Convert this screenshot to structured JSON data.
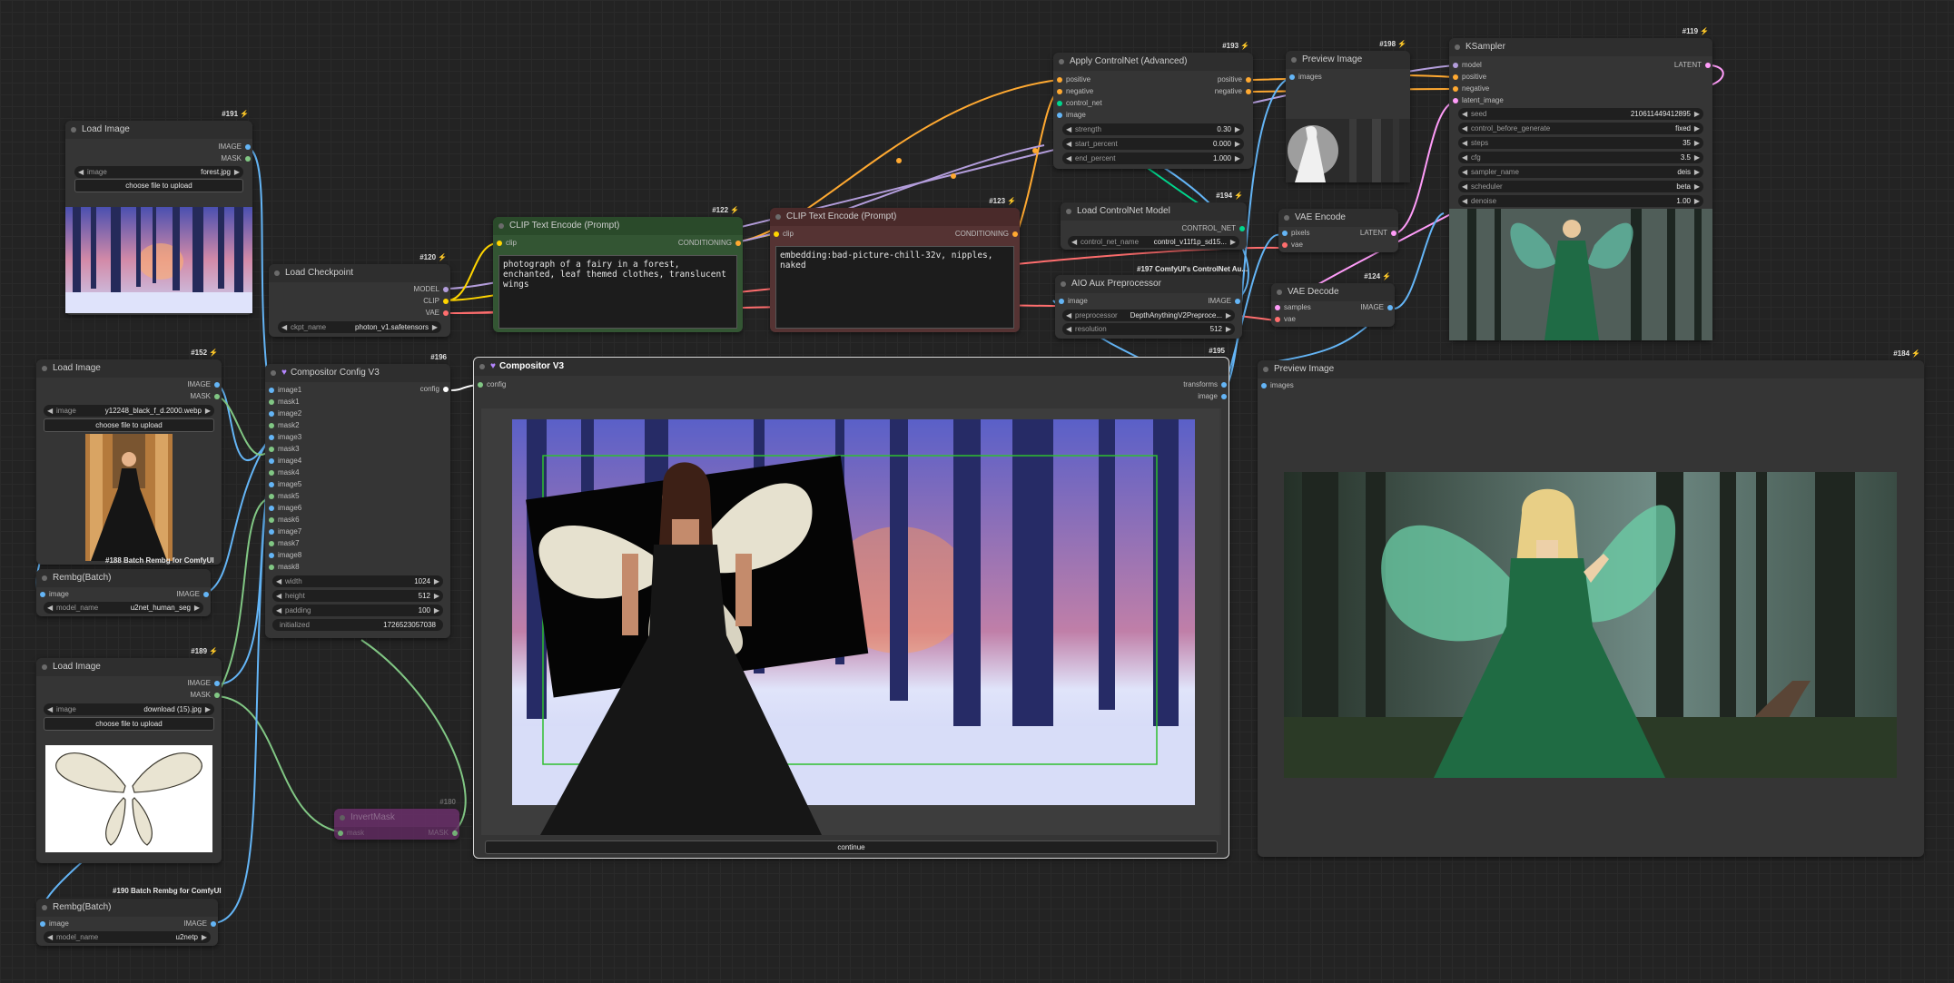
{
  "colors": {
    "image": "#64b5f6",
    "mask": "#81c784",
    "model": "#b39ddb",
    "clip": "#ffd500",
    "vae": "#ff6e6e",
    "conditioning": "#ffa931",
    "control_net": "#00d78d",
    "latent": "#ff9cf9",
    "config": "#ffffff"
  },
  "nodes": {
    "load_image_191": {
      "id": "#191",
      "title": "Load Image",
      "out_image": "IMAGE",
      "out_mask": "MASK",
      "image_label": "image",
      "image_value": "forest.jpg",
      "upload": "choose file to upload"
    },
    "load_checkpoint": {
      "id": "#120",
      "title": "Load Checkpoint",
      "out_model": "MODEL",
      "out_clip": "CLIP",
      "out_vae": "VAE",
      "ckpt_label": "ckpt_name",
      "ckpt_value": "photon_v1.safetensors"
    },
    "clip_pos": {
      "id": "#122",
      "title": "CLIP Text Encode (Prompt)",
      "in_clip": "clip",
      "out": "CONDITIONING",
      "text": "photograph of a fairy in a forest, enchanted, leaf themed clothes, translucent wings"
    },
    "clip_neg": {
      "id": "#123",
      "title": "CLIP Text Encode (Prompt)",
      "in_clip": "clip",
      "out": "CONDITIONING",
      "text": "embedding:bad-picture-chill-32v, nipples, naked"
    },
    "apply_controlnet": {
      "id": "#193",
      "title": "Apply ControlNet (Advanced)",
      "in_positive": "positive",
      "in_negative": "negative",
      "in_control_net": "control_net",
      "in_image": "image",
      "out_positive": "positive",
      "out_negative": "negative",
      "w_strength_label": "strength",
      "w_strength": "0.30",
      "w_start_label": "start_percent",
      "w_start": "0.000",
      "w_end_label": "end_percent",
      "w_end": "1.000"
    },
    "load_controlnet": {
      "id": "#194",
      "title": "Load ControlNet Model",
      "out": "CONTROL_NET",
      "name_label": "control_net_name",
      "name_value": "control_v11f1p_sd15..."
    },
    "aio_aux": {
      "id": "#197 ComfyUI's ControlNet Au...",
      "title": "AIO Aux Preprocessor",
      "in_image": "image",
      "out_image": "IMAGE",
      "pre_label": "preprocessor",
      "pre_value": "DepthAnythingV2Preproce...",
      "res_label": "resolution",
      "res_value": "512"
    },
    "preview_198": {
      "id": "#198",
      "title": "Preview Image",
      "in_images": "images"
    },
    "vae_encode": {
      "title": "VAE Encode",
      "in_pixels": "pixels",
      "in_vae": "vae",
      "out": "LATENT"
    },
    "vae_decode": {
      "id": "#124",
      "title": "VAE Decode",
      "in_samples": "samples",
      "in_vae": "vae",
      "out": "IMAGE"
    },
    "ksampler": {
      "id": "#119",
      "title": "KSampler",
      "in_model": "model",
      "in_positive": "positive",
      "in_negative": "negative",
      "in_latent": "latent_image",
      "out": "LATENT",
      "widgets": [
        {
          "label": "seed",
          "value": "210611449412895"
        },
        {
          "label": "control_before_generate",
          "value": "fixed"
        },
        {
          "label": "steps",
          "value": "35"
        },
        {
          "label": "cfg",
          "value": "3.5"
        },
        {
          "label": "sampler_name",
          "value": "deis"
        },
        {
          "label": "scheduler",
          "value": "beta"
        },
        {
          "label": "denoise",
          "value": "1.00"
        }
      ]
    },
    "load_image_152": {
      "id": "#152",
      "title": "Load Image",
      "out_image": "IMAGE",
      "out_mask": "MASK",
      "image_label": "image",
      "image_value": "y12248_black_f_d.2000.webp",
      "upload": "choose file to upload",
      "overlay": "#188 Batch Rembg for ComfyUI"
    },
    "rembg_1": {
      "title": "Rembg(Batch)",
      "in_image": "image",
      "out_image": "IMAGE",
      "model_label": "model_name",
      "model_value": "u2net_human_seg"
    },
    "compositor_config": {
      "id": "#196",
      "title": "Compositor Config V3",
      "out": "config",
      "inputs": [
        "image1",
        "mask1",
        "image2",
        "mask2",
        "image3",
        "mask3",
        "image4",
        "mask4",
        "image5",
        "mask5",
        "image6",
        "mask6",
        "image7",
        "mask7",
        "image8",
        "mask8"
      ],
      "w_width_label": "width",
      "w_width": "1024",
      "w_height_label": "height",
      "w_height": "512",
      "w_padding_label": "padding",
      "w_padding": "100",
      "w_init_label": "initialized",
      "w_init": "1726523057038"
    },
    "compositor": {
      "id": "#195",
      "title": "Compositor V3",
      "in_config": "config",
      "out_transforms": "transforms",
      "out_image": "image",
      "continue": "continue"
    },
    "preview_184": {
      "id": "#184",
      "title": "Preview Image",
      "in_images": "images"
    },
    "load_image_189": {
      "id": "#189",
      "title": "Load Image",
      "out_image": "IMAGE",
      "out_mask": "MASK",
      "image_label": "image",
      "image_value": "download (15).jpg",
      "upload": "choose file to upload"
    },
    "invert_mask": {
      "id": "#180",
      "title": "InvertMask",
      "in_mask": "mask",
      "out": "MASK"
    },
    "rembg_2": {
      "title": "Rembg(Batch)",
      "overlay": "#190 Batch Rembg for ComfyUI",
      "in_image": "image",
      "out_image": "IMAGE",
      "model_label": "model_name",
      "model_value": "u2netp"
    }
  }
}
